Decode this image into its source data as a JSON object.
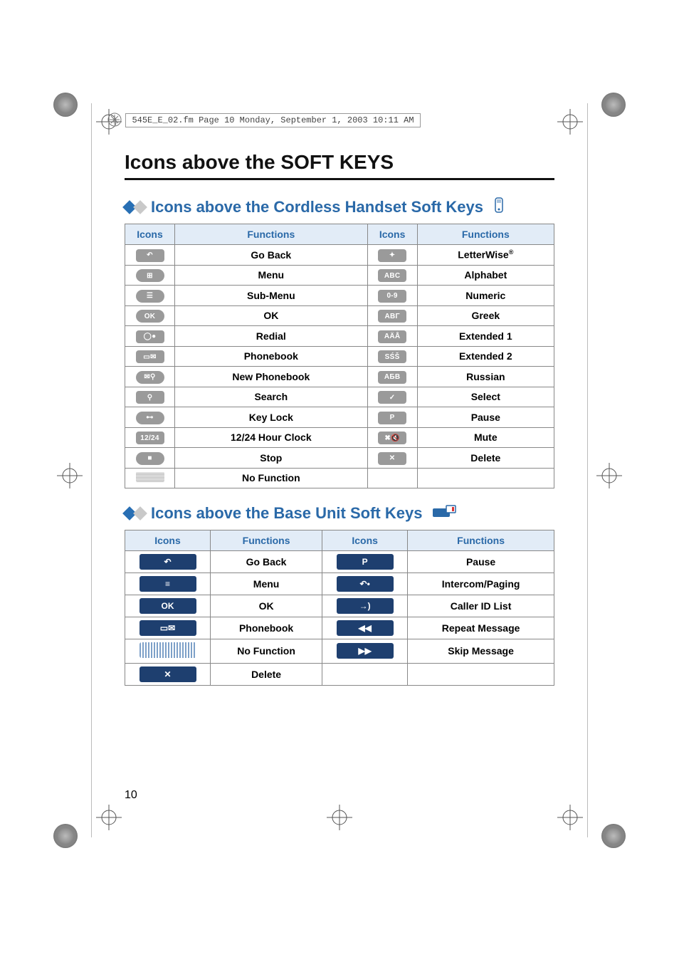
{
  "header_text": "545E_E_02.fm  Page 10  Monday, September 1, 2003  10:11 AM",
  "page_title": "Icons above the SOFT KEYS",
  "section1_title": "Icons above the Cordless Handset Soft Keys",
  "section2_title": "Icons above the Base Unit Soft Keys",
  "page_number": "10",
  "col_icons": "Icons",
  "col_functions": "Functions",
  "handset_rows_left": [
    {
      "icon_name": "go-back-icon",
      "icon_text": "↶",
      "function": "Go Back",
      "pill_class": "pill"
    },
    {
      "icon_name": "menu-icon",
      "icon_text": "⊞",
      "function": "Menu",
      "pill_class": "pill rounded"
    },
    {
      "icon_name": "submenu-icon",
      "icon_text": "☰",
      "function": "Sub-Menu",
      "pill_class": "pill rounded"
    },
    {
      "icon_name": "ok-icon",
      "icon_text": "OK",
      "function": "OK",
      "pill_class": "pill rounded"
    },
    {
      "icon_name": "redial-icon",
      "icon_text": "◯●",
      "function": "Redial",
      "pill_class": "pill"
    },
    {
      "icon_name": "phonebook-icon",
      "icon_text": "▭✉",
      "function": "Phonebook",
      "pill_class": "pill"
    },
    {
      "icon_name": "new-phonebook-icon",
      "icon_text": "✉⚲",
      "function": "New Phonebook",
      "pill_class": "pill rounded"
    },
    {
      "icon_name": "search-icon",
      "icon_text": "⚲",
      "function": "Search",
      "pill_class": "pill"
    },
    {
      "icon_name": "key-lock-icon",
      "icon_text": "⊷",
      "function": "Key Lock",
      "pill_class": "pill rounded"
    },
    {
      "icon_name": "clock-1224-icon",
      "icon_text": "12/24",
      "function": "12/24 Hour Clock",
      "pill_class": "pill"
    },
    {
      "icon_name": "stop-icon",
      "icon_text": "■",
      "function": "Stop",
      "pill_class": "pill rounded"
    },
    {
      "icon_name": "no-function-icon",
      "icon_text": "",
      "function": "No Function",
      "pill_class": "pill dotted"
    }
  ],
  "handset_rows_right": [
    {
      "icon_name": "letterwise-icon",
      "icon_text": "✦",
      "function_html": "LetterWise<sup>®</sup>",
      "pill_class": "pill"
    },
    {
      "icon_name": "alphabet-icon",
      "icon_text": "ABC",
      "function": "Alphabet",
      "pill_class": "pill"
    },
    {
      "icon_name": "numeric-icon",
      "icon_text": "0-9",
      "function": "Numeric",
      "pill_class": "pill"
    },
    {
      "icon_name": "greek-icon",
      "icon_text": "ΑΒΓ",
      "function": "Greek",
      "pill_class": "pill"
    },
    {
      "icon_name": "extended1-icon",
      "icon_text": "AÄÅ",
      "function": "Extended 1",
      "pill_class": "pill"
    },
    {
      "icon_name": "extended2-icon",
      "icon_text": "SŚŠ",
      "function": "Extended 2",
      "pill_class": "pill"
    },
    {
      "icon_name": "russian-icon",
      "icon_text": "АБВ",
      "function": "Russian",
      "pill_class": "pill"
    },
    {
      "icon_name": "select-icon",
      "icon_text": "✓",
      "function": "Select",
      "pill_class": "pill"
    },
    {
      "icon_name": "pause-icon",
      "icon_text": "P",
      "function": "Pause",
      "pill_class": "pill"
    },
    {
      "icon_name": "mute-icon",
      "icon_text": "✖🔇",
      "function": "Mute",
      "pill_class": "pill"
    },
    {
      "icon_name": "delete-icon",
      "icon_text": "✕",
      "function": "Delete",
      "pill_class": "pill"
    }
  ],
  "base_rows_left": [
    {
      "icon_name": "base-go-back-icon",
      "icon_text": "↶",
      "function": "Go Back"
    },
    {
      "icon_name": "base-menu-icon",
      "icon_text": "≡",
      "function": "Menu"
    },
    {
      "icon_name": "base-ok-icon",
      "icon_text": "OK",
      "function": "OK"
    },
    {
      "icon_name": "base-phonebook-icon",
      "icon_text": "▭✉",
      "function": "Phonebook"
    },
    {
      "icon_name": "base-no-function-icon",
      "icon_text": "",
      "function": "No Function",
      "bar_class": "bar dotted"
    },
    {
      "icon_name": "base-delete-icon",
      "icon_text": "✕",
      "function": "Delete"
    }
  ],
  "base_rows_right": [
    {
      "icon_name": "base-pause-icon",
      "icon_text": "P",
      "function": "Pause"
    },
    {
      "icon_name": "base-intercom-icon",
      "icon_text": "↶•",
      "function": "Intercom/Paging"
    },
    {
      "icon_name": "base-callerid-icon",
      "icon_text": "→)",
      "function": "Caller ID List"
    },
    {
      "icon_name": "base-repeat-icon",
      "icon_text": "◀◀",
      "function": "Repeat Message"
    },
    {
      "icon_name": "base-skip-icon",
      "icon_text": "▶▶",
      "function": "Skip Message"
    }
  ]
}
